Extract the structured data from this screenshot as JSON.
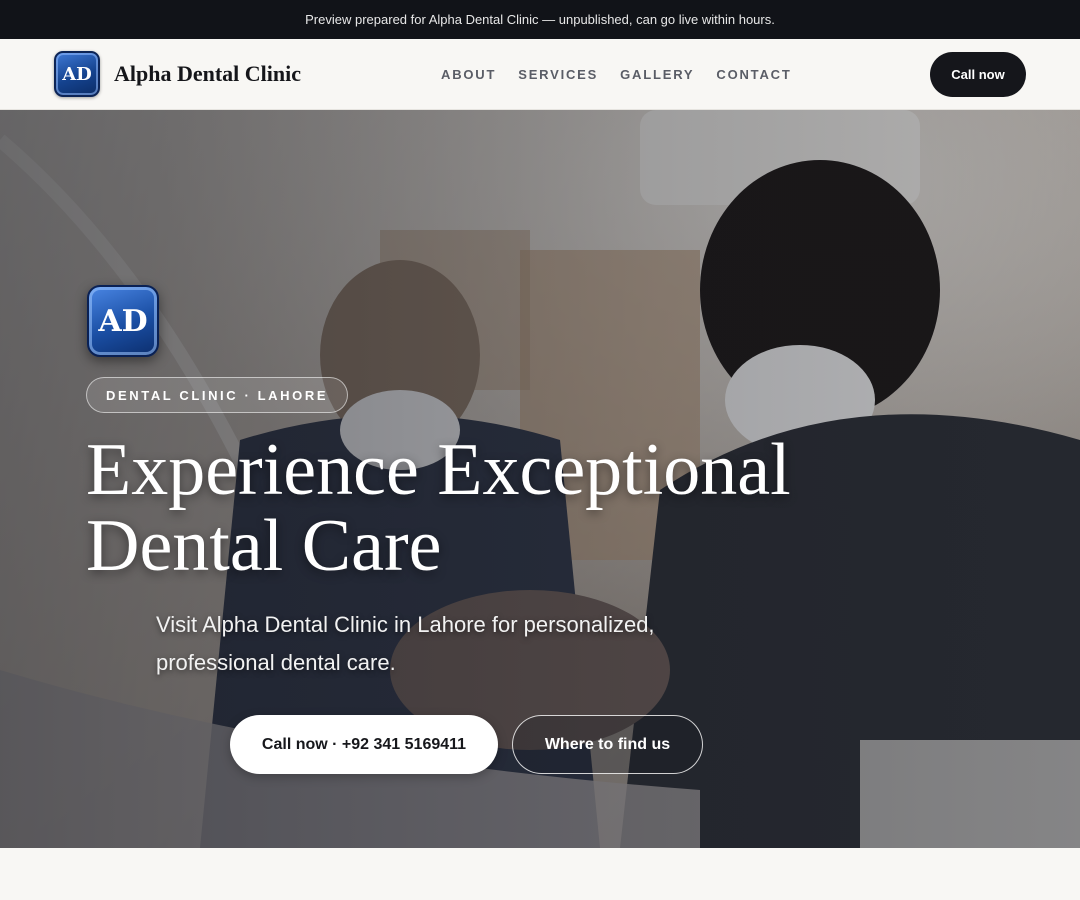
{
  "preview_banner": {
    "text": "Preview prepared for Alpha Dental Clinic — unpublished, can go live within hours."
  },
  "header": {
    "logo_text": "AD",
    "brand_name": "Alpha Dental Clinic",
    "nav": [
      "ABOUT",
      "SERVICES",
      "GALLERY",
      "CONTACT"
    ],
    "cta_label": "Call now"
  },
  "hero": {
    "logo_text": "AD",
    "tag": "DENTAL CLINIC · LAHORE",
    "title_line1": "Experience Exceptional",
    "title_line2": "Dental Care",
    "subtitle_line1": "Visit Alpha Dental Clinic in Lahore for personalized,",
    "subtitle_line2": "professional dental care.",
    "primary_button": "Call now · +92 341 5169411",
    "secondary_button": "Where to find us",
    "background_image": "dentist-and-assistant-treating-patient-photo"
  },
  "colors": {
    "topbar": "#111318",
    "header_bg": "#f8f7f4",
    "cta_dark": "#15161b",
    "logo_blue": "#15438f"
  }
}
